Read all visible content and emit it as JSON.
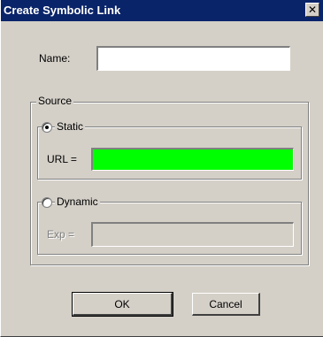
{
  "window": {
    "title": "Create Symbolic Link",
    "close_icon": "✕"
  },
  "form": {
    "name_label": "Name:",
    "name_value": "",
    "source_group_label": "Source",
    "static_group": {
      "radio_label": "Static",
      "selected": true,
      "url_label": "URL =",
      "url_value": "",
      "url_field_color": "#00ff00"
    },
    "dynamic_group": {
      "radio_label": "Dynamic",
      "selected": false,
      "exp_label": "Exp =",
      "exp_value": ""
    }
  },
  "buttons": {
    "ok_label": "OK",
    "cancel_label": "Cancel"
  }
}
